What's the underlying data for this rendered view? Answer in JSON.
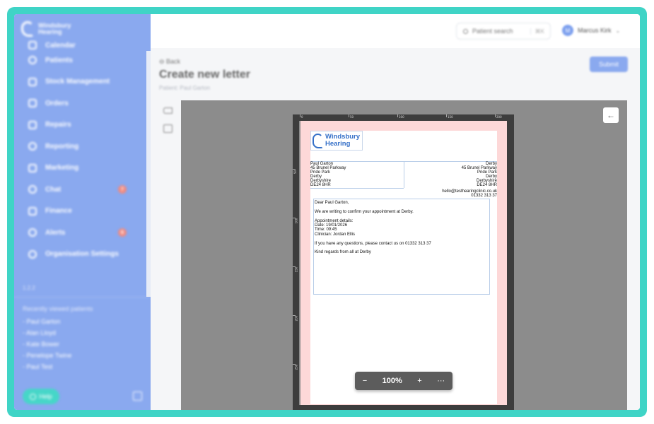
{
  "app": {
    "logo_text_line1": "Windsbury",
    "logo_text_line2": "Hearing"
  },
  "sidebar": {
    "items": [
      {
        "label": "Calendar",
        "icon": "calendar-icon"
      },
      {
        "label": "Patients",
        "icon": "patients-icon"
      },
      {
        "label": "Stock Management",
        "icon": "stock-icon"
      },
      {
        "label": "Orders",
        "icon": "orders-icon"
      },
      {
        "label": "Repairs",
        "icon": "wrench-icon"
      },
      {
        "label": "Reporting",
        "icon": "chart-icon"
      },
      {
        "label": "Marketing",
        "icon": "mail-icon"
      },
      {
        "label": "Chat",
        "icon": "chat-icon",
        "badge": "7"
      },
      {
        "label": "Finance",
        "icon": "card-icon"
      },
      {
        "label": "Alerts",
        "icon": "bell-icon",
        "badge": "6"
      },
      {
        "label": "Organisation Settings",
        "icon": "gear-icon"
      }
    ],
    "version": "1.2.2",
    "recent_title": "Recently viewed patients",
    "recent": [
      "- Paul Garton",
      "- Alan Lloyd",
      "- Kate Bower",
      "- Penelope Twine",
      "- Paul Test"
    ],
    "help_label": "Help"
  },
  "topbar": {
    "search_placeholder": "Patient search",
    "search_shortcut": "⌘K",
    "user_initial": "M",
    "user_name": "Marcus Kirk"
  },
  "header": {
    "back_label": "Back",
    "title": "Create new letter",
    "subtitle": "Patient: Paul Garton",
    "submit_label": "Submit"
  },
  "ruler": {
    "h_labels": [
      "0",
      "50",
      "100",
      "150",
      "200"
    ],
    "v_labels": [
      "50",
      "100",
      "150",
      "200",
      "250"
    ]
  },
  "letter": {
    "logo_line1": "Windsbury",
    "logo_line2": "Hearing",
    "recipient": [
      "Paul Garton",
      "45 Brunel Parkway",
      "Pride Park",
      "Derby",
      "Derbyshire",
      "DE24 8HR"
    ],
    "sender": [
      "Derby",
      "45 Brunel Parkway",
      "Pride Park",
      "Derby",
      "Derbyshire",
      "DE24 8HR"
    ],
    "email": "hello@testhearingclinic.co.uk",
    "phone": "01332 313 37",
    "greeting": "Dear Paul Garton,",
    "intro": "We are writing to confirm your appointment at Derby.",
    "details_title": "Appointment details:",
    "date": "Date: 19/01/2026",
    "time": "Time: 09:45",
    "clinician": "Clinician: Jordan Ellis",
    "questions": "If you have any questions, please contact us on 01332 313 37",
    "closing": "Kind regards from all at Derby"
  },
  "zoom": {
    "minus": "−",
    "level": "100%",
    "plus": "+",
    "more": "···"
  },
  "colors": {
    "frame": "#3fd4c6",
    "sidebar": "#8aa9ef",
    "brand": "#3570c8",
    "canvas": "#8c8c8c",
    "bleed": "#fdd8d8"
  }
}
